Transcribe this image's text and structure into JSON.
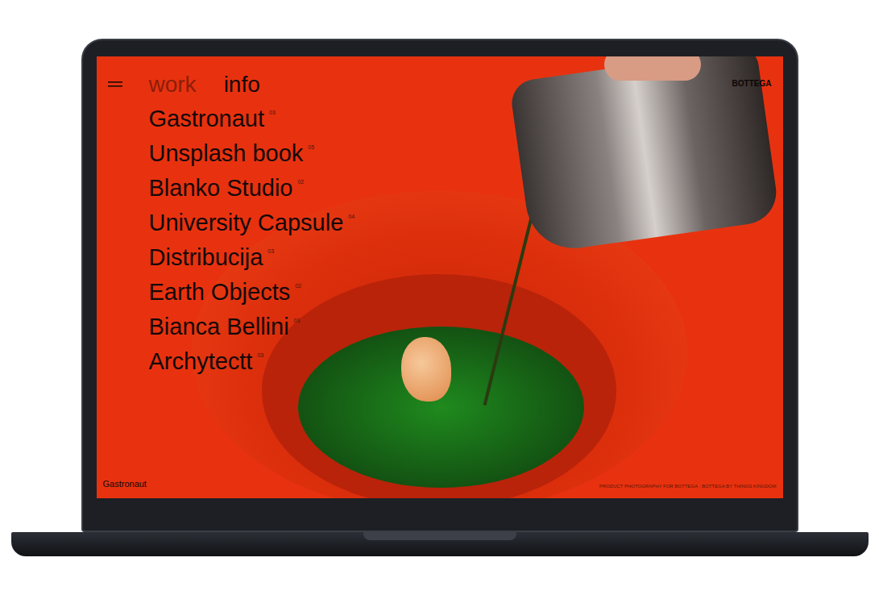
{
  "tabs": [
    {
      "label": "work",
      "selected": true
    },
    {
      "label": "info",
      "selected": false
    }
  ],
  "logo": "BOTTEGA",
  "projects": [
    {
      "name": "Gastronaut",
      "count": "03"
    },
    {
      "name": "Unsplash book",
      "count": "05"
    },
    {
      "name": "Blanko Studio",
      "count": "02"
    },
    {
      "name": "University Capsule",
      "count": "04"
    },
    {
      "name": "Distribucija",
      "count": "03"
    },
    {
      "name": "Earth Objects",
      "count": "02"
    },
    {
      "name": "Bianca Bellini",
      "count": "03"
    },
    {
      "name": "Archytectt",
      "count": "03"
    }
  ],
  "caption": "Gastronaut",
  "credit": "PRODUCT PHOTOGRAPHY FOR BOTTEGA · BOTTEGA BY THINGS KINGDOM"
}
